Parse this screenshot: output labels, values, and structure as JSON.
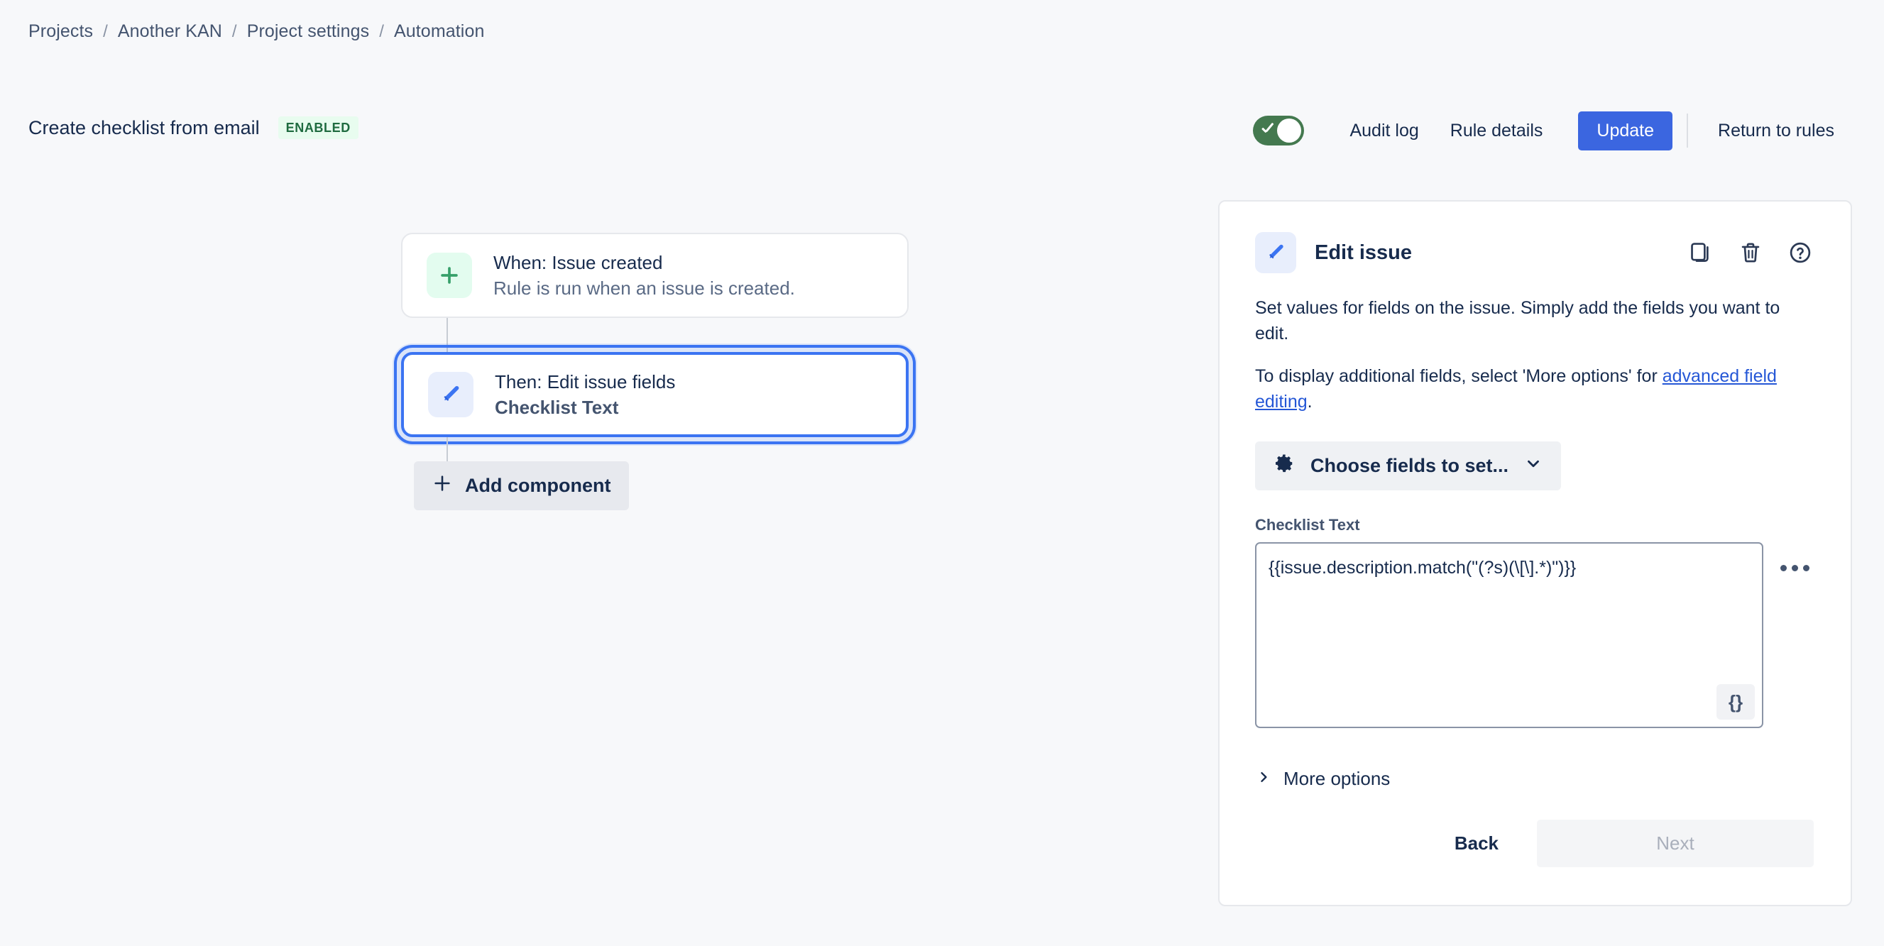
{
  "breadcrumb": [
    {
      "label": "Projects"
    },
    {
      "label": "Another KAN"
    },
    {
      "label": "Project settings"
    },
    {
      "label": "Automation"
    }
  ],
  "breadcrumb_separator": "/",
  "header": {
    "rule_name": "Create checklist from email",
    "status_badge": "ENABLED",
    "toggle_state": "on",
    "audit_log_label": "Audit log",
    "rule_details_label": "Rule details",
    "update_label": "Update",
    "return_to_rules_label": "Return to rules",
    "accent_color": "#3b66e0",
    "toggle_color": "#44794f",
    "badge_bg": "#e8fcef",
    "badge_color": "#1f6b40"
  },
  "tree": {
    "nodes": [
      {
        "icon": "plus-icon",
        "icon_theme": "green",
        "title": "When: Issue created",
        "subtitle": "Rule is run when an issue is created.",
        "selected": false
      },
      {
        "icon": "pencil-icon",
        "icon_theme": "blue",
        "title": "Then: Edit issue fields",
        "subtitle": "Checklist Text",
        "selected": true
      }
    ],
    "add_component_label": "Add component"
  },
  "panel": {
    "icon": "pencil-icon",
    "title": "Edit issue",
    "actions": [
      {
        "name": "duplicate-icon"
      },
      {
        "name": "trash-icon"
      },
      {
        "name": "help-icon"
      }
    ],
    "description_1": "Set values for fields on the issue. Simply add the fields you want to edit.",
    "description_2_before": "To display additional fields, select 'More options' for ",
    "description_2_link": "advanced field editing",
    "description_2_after": ".",
    "choose_fields_label": "Choose fields to set...",
    "field": {
      "label": "Checklist Text",
      "value": "{{issue.description.match(\"(?s)(\\[\\].*)\")}}",
      "smart_values_label": "{}"
    },
    "more_options_label": "More options",
    "back_label": "Back",
    "next_label": "Next"
  }
}
